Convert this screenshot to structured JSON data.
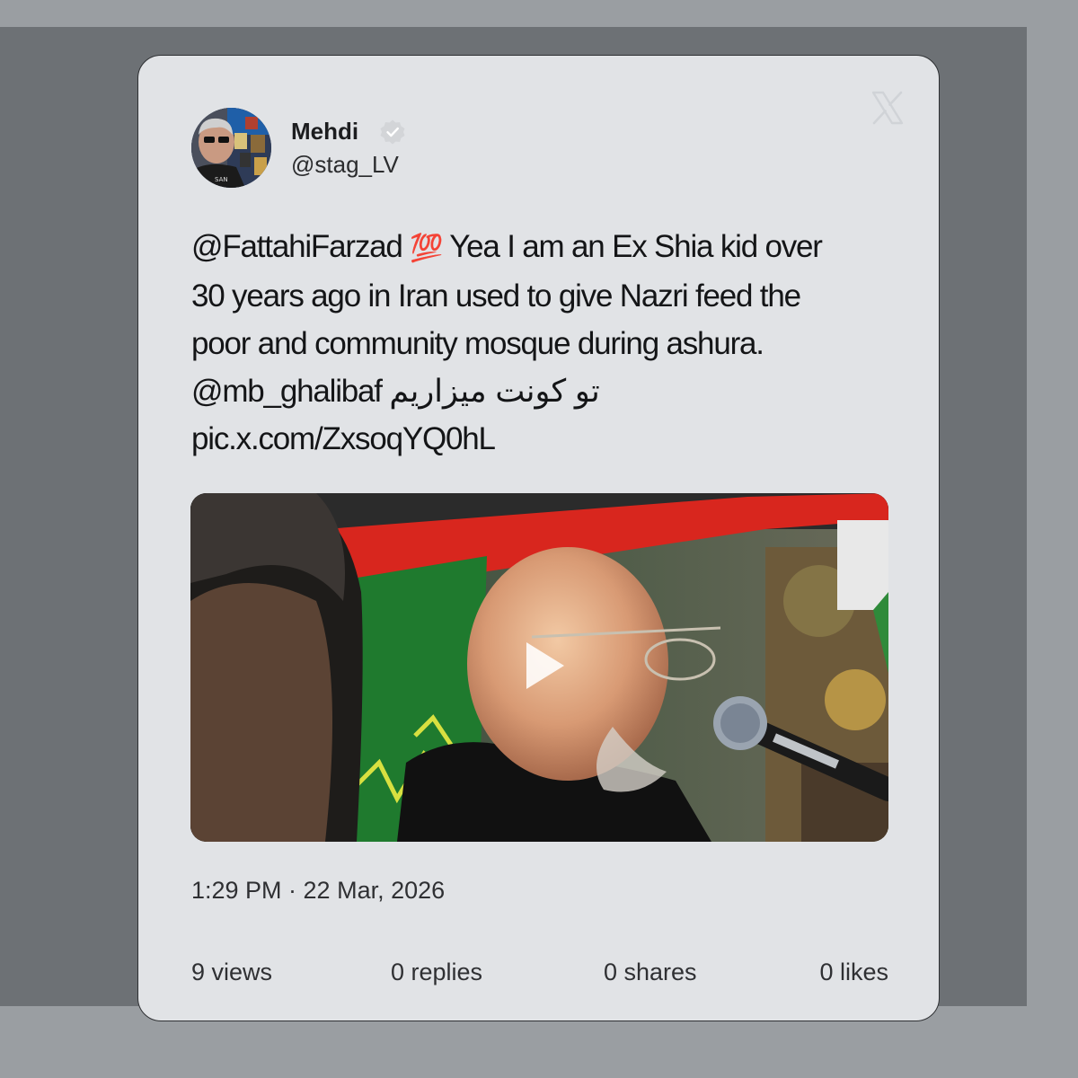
{
  "post": {
    "author": {
      "display_name": "Mehdi",
      "handle": "@stag_LV",
      "verified_icon": "verified-badge-icon",
      "avatar_icon": "user-avatar"
    },
    "brand_icon": "x-logo-icon",
    "text_lines": [
      {
        "before": "@FattahiFarzad ",
        "emoji": "💯",
        "after": " Yea I am an Ex Shia kid over"
      },
      {
        "text": "30 years ago in Iran used to give Nazri feed the"
      },
      {
        "text": "poor and community mosque during ashura."
      },
      {
        "text": "@mb_ghalibaf  تو کونت میزاریم"
      },
      {
        "text": "pic.x.com/ZxsoqYQ0hL"
      }
    ],
    "media": {
      "type": "video",
      "play_icon": "play-icon"
    },
    "timestamp": "1:29 PM · 22 Mar, 2026",
    "stats": {
      "views": "9 views",
      "replies": "0 replies",
      "shares": "0 shares",
      "likes": "0 likes"
    }
  },
  "colors": {
    "page_background": "#9a9ea2",
    "backdrop_shadow": "#6d7175",
    "card_background": "#e1e3e6",
    "card_border": "#2e3033",
    "text_primary": "#141517",
    "text_secondary": "#2f3033",
    "emoji_red": "#d5303b"
  }
}
